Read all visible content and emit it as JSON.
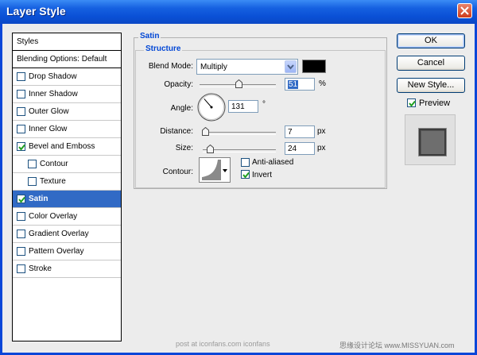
{
  "window": {
    "title": "Layer Style"
  },
  "styles_list": {
    "header": "Styles",
    "blending_options": "Blending Options: Default",
    "items": [
      {
        "label": "Drop Shadow",
        "checked": false,
        "indent": false,
        "selected": false
      },
      {
        "label": "Inner Shadow",
        "checked": false,
        "indent": false,
        "selected": false
      },
      {
        "label": "Outer Glow",
        "checked": false,
        "indent": false,
        "selected": false
      },
      {
        "label": "Inner Glow",
        "checked": false,
        "indent": false,
        "selected": false
      },
      {
        "label": "Bevel and Emboss",
        "checked": true,
        "indent": false,
        "selected": false
      },
      {
        "label": "Contour",
        "checked": false,
        "indent": true,
        "selected": false
      },
      {
        "label": "Texture",
        "checked": false,
        "indent": true,
        "selected": false
      },
      {
        "label": "Satin",
        "checked": true,
        "indent": false,
        "selected": true
      },
      {
        "label": "Color Overlay",
        "checked": false,
        "indent": false,
        "selected": false
      },
      {
        "label": "Gradient Overlay",
        "checked": false,
        "indent": false,
        "selected": false
      },
      {
        "label": "Pattern Overlay",
        "checked": false,
        "indent": false,
        "selected": false
      },
      {
        "label": "Stroke",
        "checked": false,
        "indent": false,
        "selected": false
      }
    ]
  },
  "satin": {
    "title": "Satin",
    "structure": {
      "title": "Structure",
      "blend_mode_label": "Blend Mode:",
      "blend_mode_value": "Multiply",
      "blend_color": "#000000",
      "opacity_label": "Opacity:",
      "opacity_value": "51",
      "opacity_fraction": 0.51,
      "opacity_unit": "%",
      "angle_label": "Angle:",
      "angle_value": "131",
      "angle_unit": "°",
      "distance_label": "Distance:",
      "distance_value": "7",
      "distance_fraction": 0.03,
      "distance_unit": "px",
      "size_label": "Size:",
      "size_value": "24",
      "size_fraction": 0.1,
      "size_unit": "px",
      "contour_label": "Contour:",
      "anti_aliased_label": "Anti-aliased",
      "anti_aliased_checked": false,
      "invert_label": "Invert",
      "invert_checked": true
    }
  },
  "buttons": {
    "ok": "OK",
    "cancel": "Cancel",
    "new_style": "New Style..."
  },
  "preview": {
    "label": "Preview",
    "checked": true
  },
  "footer": {
    "left": "post at iconfans.com iconfans",
    "right": "思缘设计论坛 www.MISSYUAN.com"
  },
  "colors": {
    "accent": "#316ac5",
    "title_blue": "#0046d5"
  }
}
